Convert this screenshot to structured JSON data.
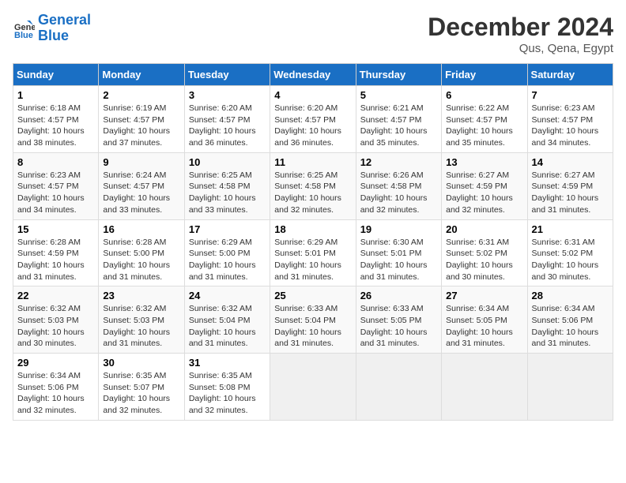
{
  "logo": {
    "line1": "General",
    "line2": "Blue"
  },
  "title": "December 2024",
  "location": "Qus, Qena, Egypt",
  "columns": [
    "Sunday",
    "Monday",
    "Tuesday",
    "Wednesday",
    "Thursday",
    "Friday",
    "Saturday"
  ],
  "weeks": [
    [
      {
        "day": "1",
        "info": "Sunrise: 6:18 AM\nSunset: 4:57 PM\nDaylight: 10 hours\nand 38 minutes."
      },
      {
        "day": "2",
        "info": "Sunrise: 6:19 AM\nSunset: 4:57 PM\nDaylight: 10 hours\nand 37 minutes."
      },
      {
        "day": "3",
        "info": "Sunrise: 6:20 AM\nSunset: 4:57 PM\nDaylight: 10 hours\nand 36 minutes."
      },
      {
        "day": "4",
        "info": "Sunrise: 6:20 AM\nSunset: 4:57 PM\nDaylight: 10 hours\nand 36 minutes."
      },
      {
        "day": "5",
        "info": "Sunrise: 6:21 AM\nSunset: 4:57 PM\nDaylight: 10 hours\nand 35 minutes."
      },
      {
        "day": "6",
        "info": "Sunrise: 6:22 AM\nSunset: 4:57 PM\nDaylight: 10 hours\nand 35 minutes."
      },
      {
        "day": "7",
        "info": "Sunrise: 6:23 AM\nSunset: 4:57 PM\nDaylight: 10 hours\nand 34 minutes."
      }
    ],
    [
      {
        "day": "8",
        "info": "Sunrise: 6:23 AM\nSunset: 4:57 PM\nDaylight: 10 hours\nand 34 minutes."
      },
      {
        "day": "9",
        "info": "Sunrise: 6:24 AM\nSunset: 4:57 PM\nDaylight: 10 hours\nand 33 minutes."
      },
      {
        "day": "10",
        "info": "Sunrise: 6:25 AM\nSunset: 4:58 PM\nDaylight: 10 hours\nand 33 minutes."
      },
      {
        "day": "11",
        "info": "Sunrise: 6:25 AM\nSunset: 4:58 PM\nDaylight: 10 hours\nand 32 minutes."
      },
      {
        "day": "12",
        "info": "Sunrise: 6:26 AM\nSunset: 4:58 PM\nDaylight: 10 hours\nand 32 minutes."
      },
      {
        "day": "13",
        "info": "Sunrise: 6:27 AM\nSunset: 4:59 PM\nDaylight: 10 hours\nand 32 minutes."
      },
      {
        "day": "14",
        "info": "Sunrise: 6:27 AM\nSunset: 4:59 PM\nDaylight: 10 hours\nand 31 minutes."
      }
    ],
    [
      {
        "day": "15",
        "info": "Sunrise: 6:28 AM\nSunset: 4:59 PM\nDaylight: 10 hours\nand 31 minutes."
      },
      {
        "day": "16",
        "info": "Sunrise: 6:28 AM\nSunset: 5:00 PM\nDaylight: 10 hours\nand 31 minutes."
      },
      {
        "day": "17",
        "info": "Sunrise: 6:29 AM\nSunset: 5:00 PM\nDaylight: 10 hours\nand 31 minutes."
      },
      {
        "day": "18",
        "info": "Sunrise: 6:29 AM\nSunset: 5:01 PM\nDaylight: 10 hours\nand 31 minutes."
      },
      {
        "day": "19",
        "info": "Sunrise: 6:30 AM\nSunset: 5:01 PM\nDaylight: 10 hours\nand 31 minutes."
      },
      {
        "day": "20",
        "info": "Sunrise: 6:31 AM\nSunset: 5:02 PM\nDaylight: 10 hours\nand 30 minutes."
      },
      {
        "day": "21",
        "info": "Sunrise: 6:31 AM\nSunset: 5:02 PM\nDaylight: 10 hours\nand 30 minutes."
      }
    ],
    [
      {
        "day": "22",
        "info": "Sunrise: 6:32 AM\nSunset: 5:03 PM\nDaylight: 10 hours\nand 30 minutes."
      },
      {
        "day": "23",
        "info": "Sunrise: 6:32 AM\nSunset: 5:03 PM\nDaylight: 10 hours\nand 31 minutes."
      },
      {
        "day": "24",
        "info": "Sunrise: 6:32 AM\nSunset: 5:04 PM\nDaylight: 10 hours\nand 31 minutes."
      },
      {
        "day": "25",
        "info": "Sunrise: 6:33 AM\nSunset: 5:04 PM\nDaylight: 10 hours\nand 31 minutes."
      },
      {
        "day": "26",
        "info": "Sunrise: 6:33 AM\nSunset: 5:05 PM\nDaylight: 10 hours\nand 31 minutes."
      },
      {
        "day": "27",
        "info": "Sunrise: 6:34 AM\nSunset: 5:05 PM\nDaylight: 10 hours\nand 31 minutes."
      },
      {
        "day": "28",
        "info": "Sunrise: 6:34 AM\nSunset: 5:06 PM\nDaylight: 10 hours\nand 31 minutes."
      }
    ],
    [
      {
        "day": "29",
        "info": "Sunrise: 6:34 AM\nSunset: 5:06 PM\nDaylight: 10 hours\nand 32 minutes."
      },
      {
        "day": "30",
        "info": "Sunrise: 6:35 AM\nSunset: 5:07 PM\nDaylight: 10 hours\nand 32 minutes."
      },
      {
        "day": "31",
        "info": "Sunrise: 6:35 AM\nSunset: 5:08 PM\nDaylight: 10 hours\nand 32 minutes."
      },
      null,
      null,
      null,
      null
    ]
  ]
}
